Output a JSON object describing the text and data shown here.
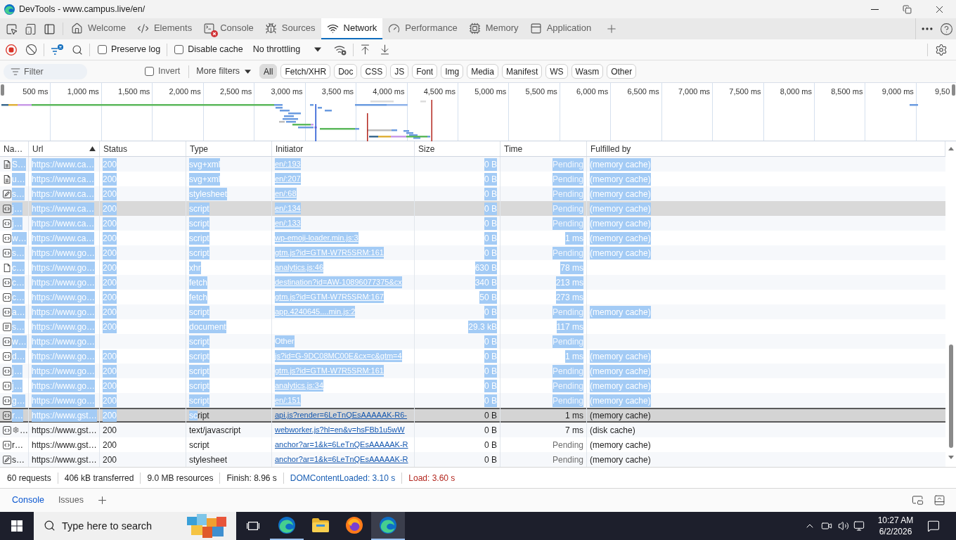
{
  "window": {
    "title": "DevTools - www.campus.live/en/"
  },
  "tabs": [
    {
      "label": "Welcome",
      "kind": "welcome",
      "selected": false,
      "error_badge": false
    },
    {
      "label": "Elements",
      "kind": "elements",
      "selected": false,
      "error_badge": false
    },
    {
      "label": "Console",
      "kind": "console",
      "selected": false,
      "error_badge": true
    },
    {
      "label": "Sources",
      "kind": "sources",
      "selected": false,
      "error_badge": false
    },
    {
      "label": "Network",
      "kind": "network",
      "selected": true,
      "error_badge": false
    },
    {
      "label": "Performance",
      "kind": "performance",
      "selected": false,
      "error_badge": false
    },
    {
      "label": "Memory",
      "kind": "memory",
      "selected": false,
      "error_badge": false
    },
    {
      "label": "Application",
      "kind": "application",
      "selected": false,
      "error_badge": false
    }
  ],
  "toolbar": {
    "recording": true,
    "checkboxes": [
      {
        "label": "Preserve log",
        "checked": false
      },
      {
        "label": "Disable cache",
        "checked": false
      }
    ],
    "throttling": "No throttling"
  },
  "filter_bar": {
    "placeholder": "Filter",
    "invert": {
      "label": "Invert",
      "checked": false
    },
    "more_filters": "More filters",
    "types": [
      {
        "label": "All",
        "selected": true
      },
      {
        "label": "Fetch/XHR",
        "selected": false
      },
      {
        "label": "Doc",
        "selected": false
      },
      {
        "label": "CSS",
        "selected": false
      },
      {
        "label": "JS",
        "selected": false
      },
      {
        "label": "Font",
        "selected": false
      },
      {
        "label": "Img",
        "selected": false
      },
      {
        "label": "Media",
        "selected": false
      },
      {
        "label": "Manifest",
        "selected": false
      },
      {
        "label": "WS",
        "selected": false
      },
      {
        "label": "Wasm",
        "selected": false
      },
      {
        "label": "Other",
        "selected": false
      }
    ]
  },
  "timeline_overview": {
    "ticks": [
      "500 ms",
      "1,000 ms",
      "1,500 ms",
      "2,000 ms",
      "2,500 ms",
      "3,000 ms",
      "3,500 ms",
      "4,000 ms",
      "4,500 ms",
      "5,000 ms",
      "5,500 ms",
      "6,000 ms",
      "6,500 ms",
      "7,000 ms",
      "7,500 ms",
      "8,000 ms",
      "8,500 ms",
      "9,000 ms",
      "9,50"
    ]
  },
  "table": {
    "columns": [
      {
        "label": "Na…",
        "sorted": false
      },
      {
        "label": "Url",
        "sorted": true
      },
      {
        "label": "Status",
        "sorted": false
      },
      {
        "label": "Type",
        "sorted": false
      },
      {
        "label": "Initiator",
        "sorted": false
      },
      {
        "label": "Size",
        "sorted": false
      },
      {
        "label": "Time",
        "sorted": false
      },
      {
        "label": "Fulfilled by",
        "sorted": false
      }
    ],
    "rows": [
      {
        "kind": "image",
        "name": "S…",
        "url": "https://www.ca…",
        "status": "200",
        "type": "svg+xml",
        "initiator": {
          "text": "en/:193",
          "link": true
        },
        "size": "0 B",
        "time": "Pending",
        "pending": true,
        "fulfilled_by": "(memory cache)",
        "text_selected": true,
        "partly_selected": false,
        "selected": false,
        "hovered": false
      },
      {
        "kind": "image",
        "name": "u…",
        "url": "https://www.ca…",
        "status": "200",
        "type": "svg+xml",
        "initiator": {
          "text": "en/:207",
          "link": true
        },
        "size": "0 B",
        "time": "Pending",
        "pending": true,
        "fulfilled_by": "(memory cache)",
        "text_selected": true,
        "partly_selected": false,
        "selected": false,
        "hovered": false
      },
      {
        "kind": "stylesheet",
        "name": "s…",
        "url": "https://www.ca…",
        "status": "200",
        "type": "stylesheet",
        "initiator": {
          "text": "en/:68",
          "link": true
        },
        "size": "0 B",
        "time": "Pending",
        "pending": true,
        "fulfilled_by": "(memory cache)",
        "text_selected": true,
        "partly_selected": false,
        "selected": false,
        "hovered": false
      },
      {
        "kind": "script",
        "name": "j…",
        "url": "https://www.ca…",
        "status": "200",
        "type": "script",
        "initiator": {
          "text": "en/:134",
          "link": true
        },
        "size": "0 B",
        "time": "Pending",
        "pending": true,
        "fulfilled_by": "(memory cache)",
        "text_selected": true,
        "partly_selected": false,
        "selected": false,
        "hovered": true
      },
      {
        "kind": "script",
        "name": "j…",
        "url": "https://www.ca…",
        "status": "200",
        "type": "script",
        "initiator": {
          "text": "en/:133",
          "link": true
        },
        "size": "0 B",
        "time": "Pending",
        "pending": true,
        "fulfilled_by": "(memory cache)",
        "text_selected": true,
        "partly_selected": false,
        "selected": false,
        "hovered": false
      },
      {
        "kind": "script",
        "name": "w…",
        "url": "https://www.ca…",
        "status": "200",
        "type": "script",
        "initiator": {
          "text": "wp-emoji-loader.min.js:3",
          "link": true
        },
        "size": "0 B",
        "time": "1 ms",
        "pending": false,
        "fulfilled_by": "(memory cache)",
        "text_selected": true,
        "partly_selected": false,
        "selected": false,
        "hovered": false
      },
      {
        "kind": "script",
        "name": "s…",
        "url": "https://www.go…",
        "status": "200",
        "type": "script",
        "initiator": {
          "text": "gtm.js?id=GTM-W7R5SRM:161",
          "link": true
        },
        "size": "0 B",
        "time": "Pending",
        "pending": true,
        "fulfilled_by": "(memory cache)",
        "text_selected": true,
        "partly_selected": false,
        "selected": false,
        "hovered": false
      },
      {
        "kind": "xhr",
        "name": "c…",
        "url": "https://www.go…",
        "status": "200",
        "type": "xhr",
        "initiator": {
          "text": "analytics.js:46",
          "link": true
        },
        "size": "630 B",
        "time": "78 ms",
        "pending": false,
        "text_selected": true,
        "partly_selected": false,
        "selected": false,
        "hovered": false
      },
      {
        "kind": "fetch",
        "name": "c…",
        "url": "https://www.go…",
        "status": "200",
        "type": "fetch",
        "initiator": {
          "text": "destination?id=AW-10896077375&cx",
          "link": true
        },
        "size": "340 B",
        "time": "213 ms",
        "pending": false,
        "text_selected": true,
        "partly_selected": false,
        "selected": false,
        "hovered": false
      },
      {
        "kind": "fetch",
        "name": "c…",
        "url": "https://www.go…",
        "status": "200",
        "type": "fetch",
        "initiator": {
          "text": "gtm.js?id=GTM-W7R5SRM:167",
          "link": true
        },
        "size": "50 B",
        "time": "273 ms",
        "pending": false,
        "text_selected": true,
        "partly_selected": false,
        "selected": false,
        "hovered": false
      },
      {
        "kind": "script",
        "name": "a…",
        "url": "https://www.go…",
        "status": "200",
        "type": "script",
        "initiator": {
          "text": "app.4240645....min.js:2",
          "link": true
        },
        "size": "0 B",
        "time": "Pending",
        "pending": true,
        "fulfilled_by": "(memory cache)",
        "text_selected": true,
        "partly_selected": false,
        "selected": false,
        "hovered": false
      },
      {
        "kind": "document",
        "name": "s…",
        "url": "https://www.go…",
        "status": "200",
        "type": "document",
        "size": "29.3 kB",
        "time": "117 ms",
        "pending": false,
        "text_selected": true,
        "partly_selected": false,
        "selected": false,
        "hovered": false
      },
      {
        "kind": "script",
        "name": "w…",
        "url": "https://www.go…",
        "type": "script",
        "initiator": {
          "text": "Other",
          "link": false
        },
        "size": "0 B",
        "time": "Pending",
        "pending": true,
        "text_selected": true,
        "partly_selected": false,
        "selected": false,
        "hovered": false
      },
      {
        "kind": "script",
        "name": "d…",
        "url": "https://www.go…",
        "status": "200",
        "type": "script",
        "initiator": {
          "text": "js?id=G-9DC08MC00E&cx=c&gtm=4",
          "link": true
        },
        "size": "0 B",
        "time": "1 ms",
        "pending": false,
        "fulfilled_by": "(memory cache)",
        "text_selected": true,
        "partly_selected": false,
        "selected": false,
        "hovered": false
      },
      {
        "kind": "script",
        "name": "j…",
        "url": "https://www.go…",
        "status": "200",
        "type": "script",
        "initiator": {
          "text": "gtm.js?id=GTM-W7R5SRM:161",
          "link": true
        },
        "size": "0 B",
        "time": "Pending",
        "pending": true,
        "fulfilled_by": "(memory cache)",
        "text_selected": true,
        "partly_selected": false,
        "selected": false,
        "hovered": false
      },
      {
        "kind": "script",
        "name": "j…",
        "url": "https://www.go…",
        "status": "200",
        "type": "script",
        "initiator": {
          "text": "analytics.js:34",
          "link": true
        },
        "size": "0 B",
        "time": "Pending",
        "pending": true,
        "fulfilled_by": "(memory cache)",
        "text_selected": true,
        "partly_selected": false,
        "selected": false,
        "hovered": false
      },
      {
        "kind": "script",
        "name": "g…",
        "url": "https://www.go…",
        "status": "200",
        "type": "script",
        "initiator": {
          "text": "en/:151",
          "link": true
        },
        "size": "0 B",
        "time": "Pending",
        "pending": true,
        "fulfilled_by": "(memory cache)",
        "text_selected": true,
        "partly_selected": false,
        "selected": false,
        "hovered": false
      },
      {
        "kind": "script",
        "name": "r…",
        "url": "https://www.gst…",
        "status": "200",
        "type": "script",
        "initiator": {
          "text": "api.js?render=6LeTnQEsAAAAAK-R6-",
          "link": true
        },
        "size": "0 B",
        "time": "1 ms",
        "pending": false,
        "fulfilled_by": "(memory cache)",
        "text_selected": true,
        "partly_selected": true,
        "selected": true,
        "hovered": false
      },
      {
        "kind": "worker",
        "name": "…",
        "url": "https://www.gst…",
        "status": "200",
        "type": "text/javascript",
        "initiator": {
          "text": "webworker.js?hl=en&v=hsFBb1u5wW",
          "link": true
        },
        "size": "0 B",
        "time": "7 ms",
        "pending": false,
        "fulfilled_by": "(disk cache)",
        "text_selected": false,
        "partly_selected": false,
        "selected": false,
        "hovered": false
      },
      {
        "kind": "script",
        "name": "r…",
        "url": "https://www.gst…",
        "status": "200",
        "type": "script",
        "initiator": {
          "text": "anchor?ar=1&k=6LeTnQEsAAAAAK-R",
          "link": true
        },
        "size": "0 B",
        "time": "Pending",
        "pending": true,
        "fulfilled_by": "(memory cache)",
        "text_selected": false,
        "partly_selected": false,
        "selected": false,
        "hovered": false
      },
      {
        "kind": "stylesheet",
        "name": "s…",
        "url": "https://www.gst…",
        "status": "200",
        "type": "stylesheet",
        "initiator": {
          "text": "anchor?ar=1&k=6LeTnQEsAAAAAK-R",
          "link": true
        },
        "size": "0 B",
        "time": "Pending",
        "pending": true,
        "fulfilled_by": "(memory cache)",
        "text_selected": false,
        "partly_selected": false,
        "selected": false,
        "hovered": false
      }
    ]
  },
  "status_bar": [
    {
      "text": "60 requests",
      "color": "#1f1f1f"
    },
    {
      "text": "406 kB transferred",
      "color": "#1f1f1f"
    },
    {
      "text": "9.0 MB resources",
      "color": "#1f1f1f"
    },
    {
      "text": "Finish: 8.96 s",
      "color": "#1f1f1f"
    },
    {
      "text": "DOMContentLoaded: 3.10 s",
      "color": "#1a5fb4"
    },
    {
      "text": "Load: 3.60 s",
      "color": "#b3261e"
    }
  ],
  "drawer": {
    "tabs": [
      {
        "label": "Console",
        "selected": true
      },
      {
        "label": "Issues",
        "selected": false
      }
    ]
  },
  "taskbar": {
    "search_placeholder": "Type here to search",
    "apps": [
      {
        "kind": "edge",
        "running": true,
        "active": false
      },
      {
        "kind": "file-explorer",
        "running": false,
        "active": false
      },
      {
        "kind": "firefox",
        "running": false,
        "active": false
      },
      {
        "kind": "edge",
        "running": true,
        "active": true
      }
    ],
    "time": "10:27 AM",
    "date": "6/2/2026"
  }
}
